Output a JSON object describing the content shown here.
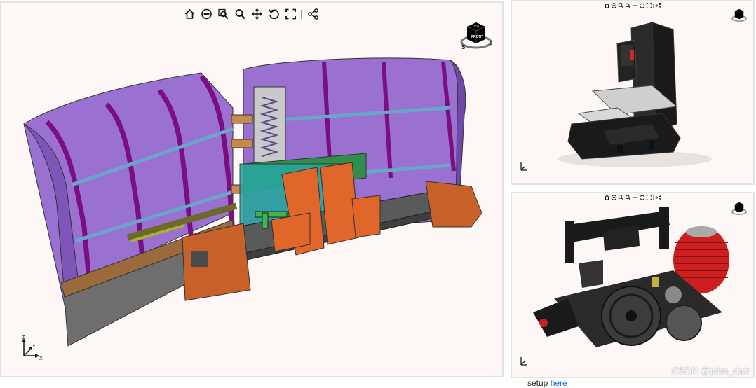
{
  "toolbar": {
    "buttons": [
      {
        "name": "home-view-button",
        "icon": "home-icon"
      },
      {
        "name": "render-mode-button",
        "icon": "eye-icon"
      },
      {
        "name": "zoom-box-button",
        "icon": "zoom-box-icon"
      },
      {
        "name": "zoom-button",
        "icon": "magnifier-icon"
      },
      {
        "name": "pan-button",
        "icon": "move-arrows-icon"
      },
      {
        "name": "rotate-button",
        "icon": "rotate-icon"
      },
      {
        "name": "fullscreen-button",
        "icon": "fullscreen-icon"
      },
      {
        "name": "share-button",
        "icon": "share-icon"
      }
    ]
  },
  "navcube": {
    "face": "FRONT",
    "top": "TOP",
    "compass_s": "S",
    "compass_e": "E"
  },
  "triad": {
    "x": "X",
    "y": "Y",
    "z": "Z"
  },
  "viewers": [
    {
      "model": "snow-plow-blade",
      "colors": {
        "blade": "#8a5cc4",
        "rib": "#7a1080",
        "frame": "#555555",
        "bracket": "#e0662a",
        "green": "#2f8f4a"
      }
    },
    {
      "model": "cnc-milling-machine",
      "colors": {
        "body": "#1a1a1a",
        "table": "#cfcfcf",
        "accent": "#cc2a2a"
      }
    },
    {
      "model": "rc-car-engine-chassis",
      "colors": {
        "frame": "#1a1a1a",
        "head": "#cc2020",
        "gear": "#3c3c3c"
      }
    }
  ],
  "watermark": "CSDN @john_dwh",
  "footer": {
    "prefix": "setup ",
    "link": "here"
  }
}
